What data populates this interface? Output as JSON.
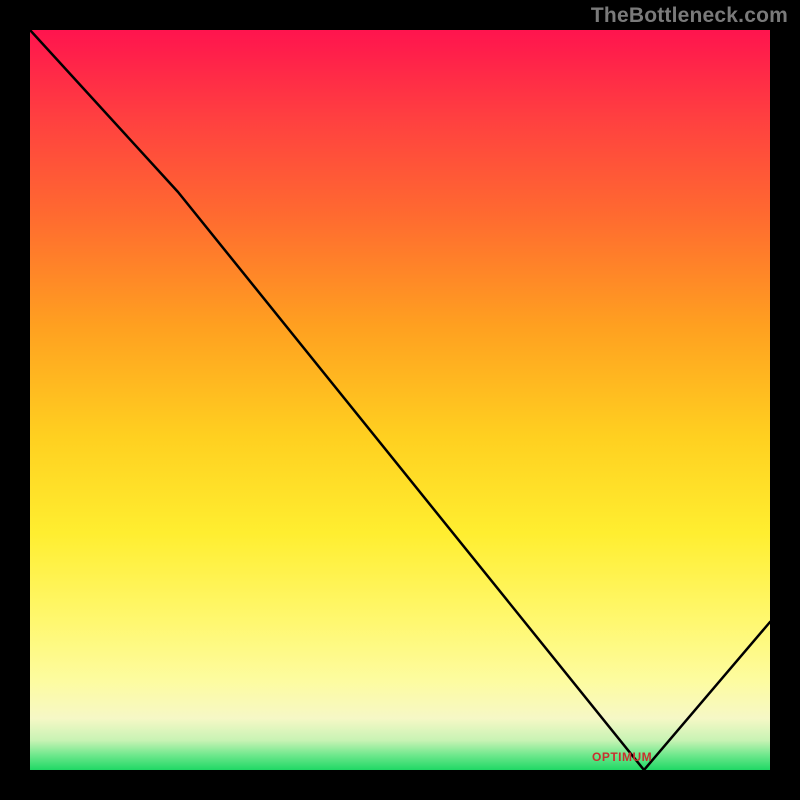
{
  "watermark": "TheBottleneck.com",
  "annotation_label": "OPTIMUM",
  "chart_data": {
    "type": "line",
    "title": "",
    "xlabel": "",
    "ylabel": "",
    "x": [
      0,
      20,
      83,
      100
    ],
    "values": [
      100,
      78,
      0,
      20
    ],
    "xlim": [
      0,
      100
    ],
    "ylim": [
      0,
      100
    ],
    "annotations": [
      {
        "x": 83,
        "y": 0,
        "label": "OPTIMUM"
      }
    ],
    "gradient_colors": {
      "top": "#ff144e",
      "bottom": "#20d865"
    }
  }
}
